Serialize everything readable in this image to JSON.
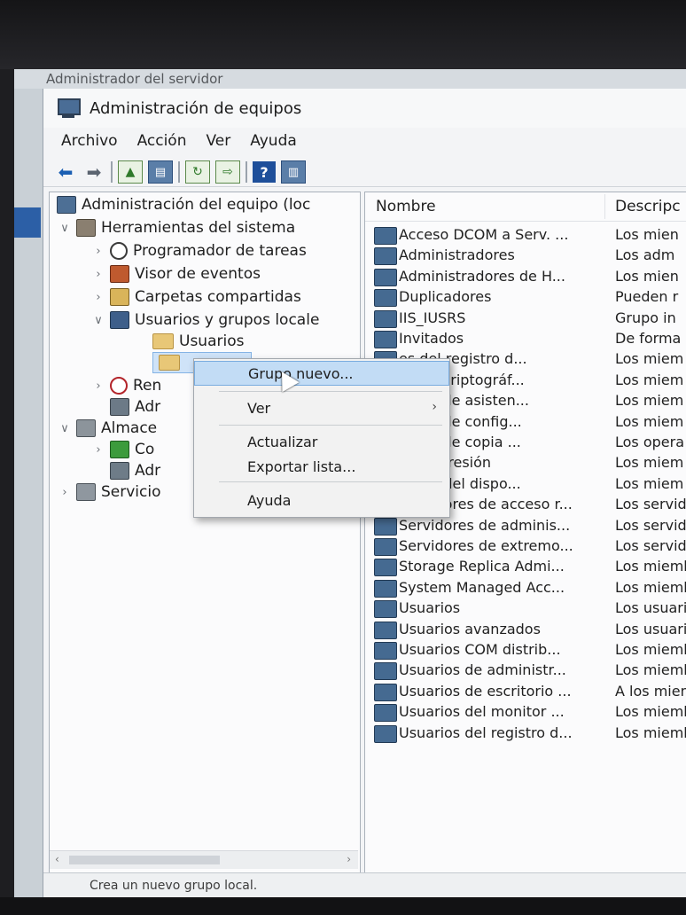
{
  "server_manager_title": "Administrador del servidor",
  "window": {
    "title": "Administración de equipos"
  },
  "menu": [
    "Archivo",
    "Acción",
    "Ver",
    "Ayuda"
  ],
  "tree": {
    "root": "Administración del equipo (loc",
    "system_tools": "Herramientas del sistema",
    "task_scheduler": "Programador de tareas",
    "event_viewer": "Visor de eventos",
    "shared_folders": "Carpetas compartidas",
    "local_users_groups": "Usuarios y grupos locale",
    "users": "Usuarios",
    "performance": "Ren",
    "device_manager": "Adr",
    "storage": "Almace",
    "backup": "Co",
    "disk_mgmt": "Adr",
    "services": "Servicio"
  },
  "list": {
    "col_name": "Nombre",
    "col_desc": "Descripc",
    "rows": [
      {
        "name": "Acceso DCOM a Serv. ...",
        "desc": "Los mien"
      },
      {
        "name": "Administradores",
        "desc": "Los adm"
      },
      {
        "name": "Administradores de H...",
        "desc": "Los mien"
      },
      {
        "name": "Duplicadores",
        "desc": "Pueden r"
      },
      {
        "name": "IIS_IUSRS",
        "desc": "Grupo in"
      },
      {
        "name": "Invitados",
        "desc": "De forma"
      },
      {
        "name": "es del registro d...",
        "desc": "Los miem"
      },
      {
        "name": "dores criptográf...",
        "desc": "Los miem"
      },
      {
        "name": "dores de asisten...",
        "desc": "Los miem"
      },
      {
        "name": "dores de config...",
        "desc": "Los miem"
      },
      {
        "name": "dores de copia ...",
        "desc": "Los opera"
      },
      {
        "name": "de impresión",
        "desc": "Los miem"
      },
      {
        "name": "tarios del dispo...",
        "desc": "Los miem"
      },
      {
        "name": "Servidores de acceso r...",
        "desc": "Los servid"
      },
      {
        "name": "Servidores de adminis...",
        "desc": "Los servid"
      },
      {
        "name": "Servidores de extremo...",
        "desc": "Los servid"
      },
      {
        "name": "Storage Replica Admi...",
        "desc": "Los miemb"
      },
      {
        "name": "System Managed Acc...",
        "desc": "Los miemb"
      },
      {
        "name": "Usuarios",
        "desc": "Los usuario"
      },
      {
        "name": "Usuarios avanzados",
        "desc": "Los usuario"
      },
      {
        "name": "Usuarios COM distrib...",
        "desc": "Los miemb"
      },
      {
        "name": "Usuarios de administr...",
        "desc": "Los miemb"
      },
      {
        "name": "Usuarios de escritorio ...",
        "desc": "A los miem"
      },
      {
        "name": "Usuarios del monitor ...",
        "desc": "Los miemb"
      },
      {
        "name": "Usuarios del registro d...",
        "desc": "Los miemb"
      }
    ]
  },
  "context_menu": {
    "new_group": "Grupo nuevo...",
    "view": "Ver",
    "refresh": "Actualizar",
    "export": "Exportar lista...",
    "help": "Ayuda"
  },
  "status": "Crea un nuevo grupo local."
}
